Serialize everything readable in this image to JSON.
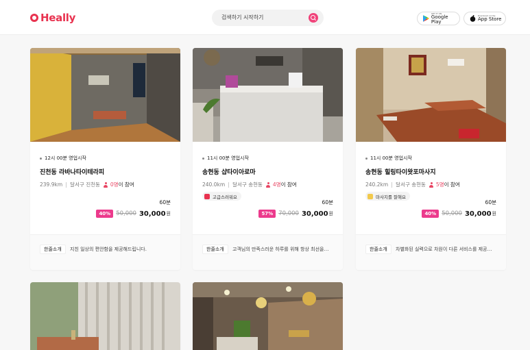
{
  "header": {
    "logo_text": "Heally",
    "search_placeholder": "검색하기 시작하기",
    "google_play_small": "GET IT ON",
    "google_play_label": "Google Play",
    "app_store_small": "Download on the",
    "app_store_label": "App Store"
  },
  "colors": {
    "brand": "#e8324f",
    "discount": "#ec3a8c",
    "search_button": "#f0437a"
  },
  "cards": [
    {
      "hours": "12시 00분 영업시작",
      "title": "진천동 라바나타이테라피",
      "distance": "239.9km",
      "location": "달서구 진천동",
      "count": "0명",
      "count_suffix": "이 참여",
      "tag": "",
      "duration": "60분",
      "discount": "40%",
      "original_price": "50,000",
      "price": "30,000",
      "currency": "원",
      "desc_label": "한줄소개",
      "desc": "지친 일상의 편안함을 제공해드립니다."
    },
    {
      "hours": "11시 00분 영업시작",
      "title": "송현동 샵타이아로마",
      "distance": "240.0km",
      "location": "달서구 송현동",
      "count": "4명",
      "count_suffix": "이 참여",
      "tag": "고급스러워요",
      "tag_icon": "premium-icon",
      "duration": "60분",
      "discount": "57%",
      "original_price": "70,000",
      "price": "30,000",
      "currency": "원",
      "desc_label": "한줄소개",
      "desc": "고객님의 만족스러운 하루를 위해 항상 최선을…"
    },
    {
      "hours": "11시 00분 영업시작",
      "title": "송현동 힐링타이왓포마사지",
      "distance": "240.2km",
      "location": "달서구 송현동",
      "count": "5명",
      "count_suffix": "이 참여",
      "tag": "마사지를 잘해요",
      "tag_icon": "thumbs-up-icon",
      "duration": "60분",
      "discount": "40%",
      "original_price": "50,000",
      "price": "30,000",
      "currency": "원",
      "desc_label": "한줄소개",
      "desc": "차별화된 실력으로 차원이 다른 서비스를 제공…"
    }
  ]
}
